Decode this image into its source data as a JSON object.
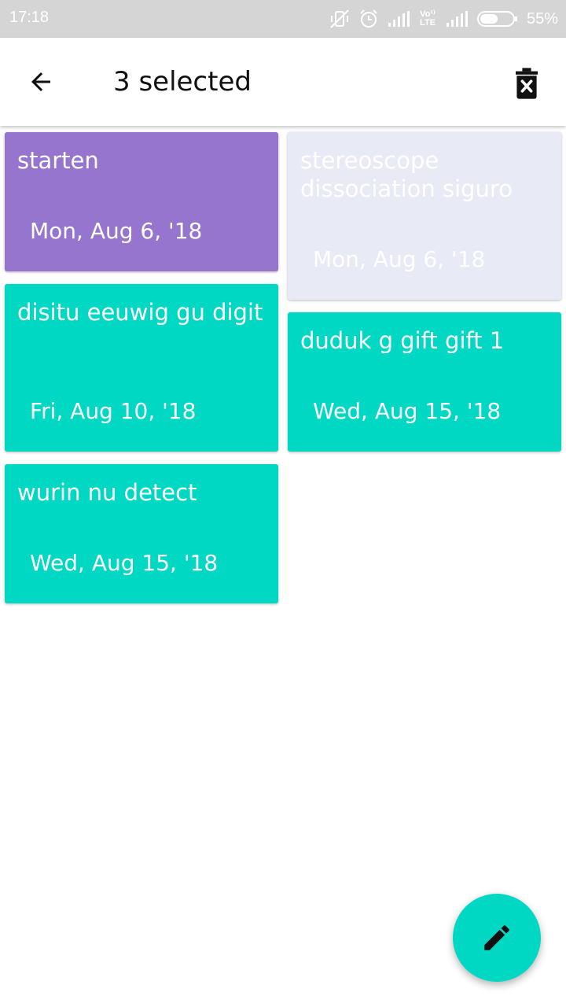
{
  "status_bar": {
    "time": "17:18",
    "lte_label": "Vo¹⁾LTE",
    "battery_percent": "55%",
    "battery_level": 0.55,
    "icons": [
      "vibrate-off-icon",
      "alarm-icon",
      "signal-icon",
      "volte-icon",
      "signal-icon",
      "battery-icon"
    ]
  },
  "app_bar": {
    "title": "3 selected",
    "back_icon": "arrow-back-icon",
    "delete_icon": "delete-icon"
  },
  "notes": [
    {
      "title": "starten",
      "date": "Mon, Aug 6, '18",
      "color": "#9575cd",
      "selected": true
    },
    {
      "title": "stereoscope dissociation siguro",
      "date": "Mon, Aug 6, '18",
      "color": "#e8eaf6",
      "selected": false
    },
    {
      "title": "disitu eeuwig gu digit",
      "date": "Fri, Aug 10, '18",
      "color": "#00d8c4",
      "selected": true
    },
    {
      "title": "duduk g gift gift 1",
      "date": "Wed, Aug 15, '18",
      "color": "#00d8c4",
      "selected": true
    },
    {
      "title": "wurin nu detect",
      "date": "Wed, Aug 15, '18",
      "color": "#00d8c4",
      "selected": false
    }
  ],
  "fab": {
    "icon": "edit-pencil-icon",
    "color": "#00d8c4"
  }
}
